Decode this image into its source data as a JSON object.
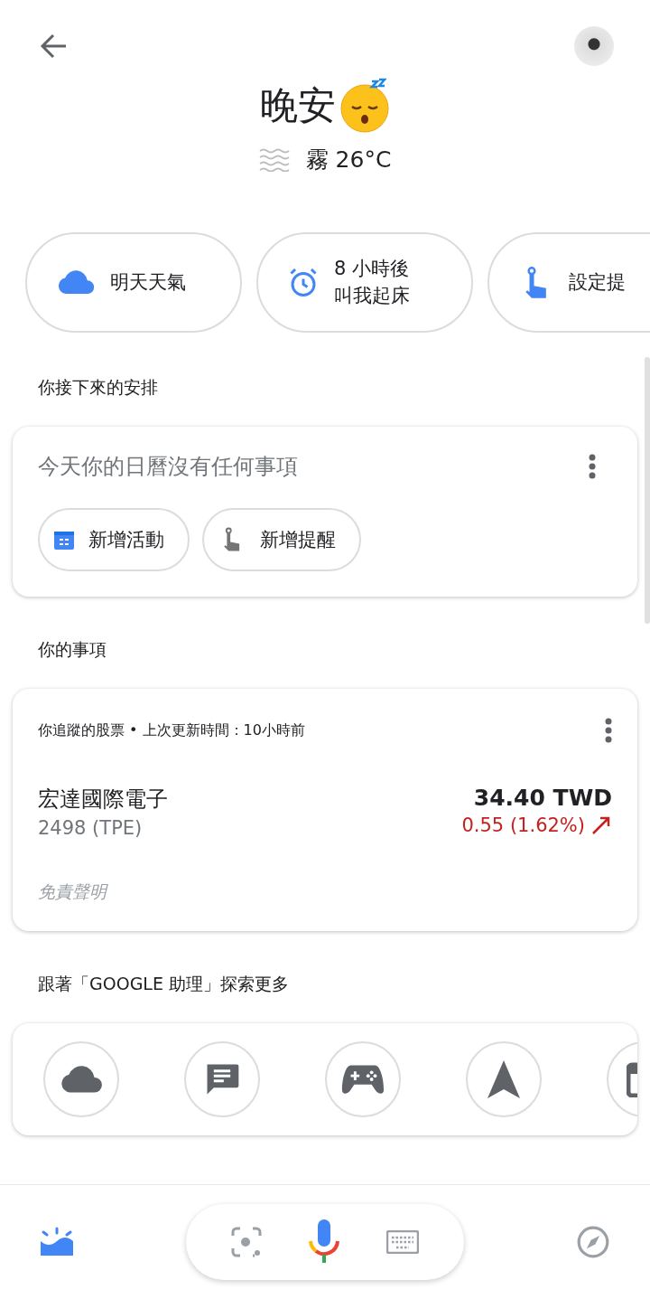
{
  "header": {
    "greeting": "晚安",
    "weather": "霧 26°C"
  },
  "chips": [
    {
      "kind": "weather",
      "label": "明天天氣"
    },
    {
      "kind": "alarm",
      "label": "8 小時後叫我起床"
    },
    {
      "kind": "reminder",
      "label": "設定提"
    }
  ],
  "schedule": {
    "title": "你接下來的安排",
    "message": "今天你的日曆沒有任何事項",
    "actions": [
      {
        "kind": "calendar",
        "label": "新增活動"
      },
      {
        "kind": "reminder",
        "label": "新增提醒"
      }
    ]
  },
  "items": {
    "title": "你的事項",
    "card_header": "你追蹤的股票 • 上次更新時間：10小時前",
    "stock": {
      "name": "宏達國際電子",
      "symbol": "2498 (TPE)",
      "price": "34.40 TWD",
      "change": "0.55 (1.62%)"
    },
    "disclaimer": "免責聲明"
  },
  "explore": {
    "title": "跟著「GOOGLE 助理」探索更多",
    "icons": [
      {
        "kind": "cloud"
      },
      {
        "kind": "message"
      },
      {
        "kind": "game"
      },
      {
        "kind": "navigation"
      },
      {
        "kind": "calendar"
      }
    ]
  },
  "bottom_bar": {
    "tabs": [
      {
        "kind": "snapshot",
        "selected": true
      },
      {
        "kind": "explore",
        "selected": false
      }
    ]
  }
}
